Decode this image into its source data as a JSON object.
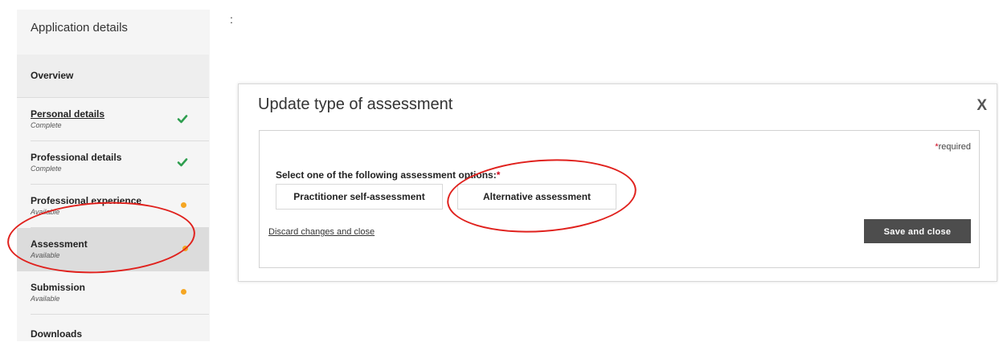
{
  "sidebar": {
    "title": "Application details",
    "items": [
      {
        "label": "Overview",
        "status": "",
        "indicator": "none"
      },
      {
        "label": "Personal details",
        "status": "Complete",
        "indicator": "check"
      },
      {
        "label": "Professional details",
        "status": "Complete",
        "indicator": "check"
      },
      {
        "label": "Professional experience",
        "status": "Available",
        "indicator": "dot"
      },
      {
        "label": "Assessment",
        "status": "Available",
        "indicator": "dot"
      },
      {
        "label": "Submission",
        "status": "Available",
        "indicator": "dot"
      },
      {
        "label": "Downloads",
        "status": "",
        "indicator": "none"
      }
    ]
  },
  "modal": {
    "title": "Update type of assessment",
    "close_label": "X",
    "required_note": "required",
    "required_star": "*",
    "question": "Select one of the following assessment options:",
    "options": [
      "Practitioner self-assessment",
      "Alternative assessment"
    ],
    "discard_label": "Discard changes and close",
    "save_label": "Save and close"
  },
  "colors": {
    "check": "#2e9e4f",
    "status_dot": "#f5a623",
    "required": "#d0021b",
    "annotation": "#e0211d",
    "save_button": "#4d4d4d"
  }
}
